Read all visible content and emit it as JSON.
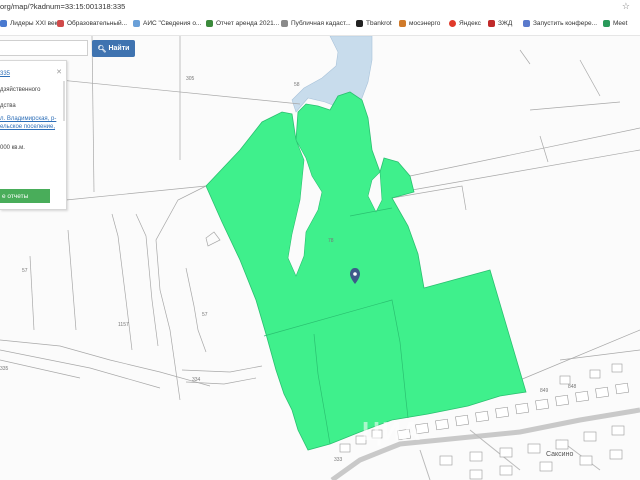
{
  "browser": {
    "url": "org/map/?kadnum=33:15:001318:335",
    "bookmarks": [
      {
        "label": "Лидеры XXI века",
        "color": "#4a7ad0"
      },
      {
        "label": "Образовательный...",
        "color": "#d04a4a"
      },
      {
        "label": "АИС \"Сведения о...",
        "color": "#6aa0d8"
      },
      {
        "label": "Отчет аренда 2021...",
        "color": "#3b8a3b"
      },
      {
        "label": "Публичная кадаст...",
        "color": "#8a8a8a"
      },
      {
        "label": "Tbankrot",
        "color": "#222222"
      },
      {
        "label": "мосэнерго",
        "color": "#d07a2a"
      },
      {
        "label": "Яндекс",
        "color": "#e03a2a"
      },
      {
        "label": "ЗЖД",
        "color": "#c02a2a"
      },
      {
        "label": "Запустить конфере...",
        "color": "#5a7acc"
      },
      {
        "label": "Meet",
        "color": "#2a9a5a"
      }
    ]
  },
  "search": {
    "button_label": "Найти"
  },
  "panel": {
    "cad_num": "335",
    "line1": "дзяйственного",
    "line2": "дства",
    "addr1": "л. Владимирская, р-",
    "addr2": "ельское поселение,",
    "area": "000 кв.м.",
    "button_label": "е отчеты"
  },
  "map": {
    "labels": {
      "l305": "305",
      "l58": "58",
      "l57": "57",
      "l57b": "57",
      "l1157": "1157",
      "l335": "335",
      "l333": "333",
      "l334": "334",
      "l849": "849",
      "l848": "848",
      "l78": "78",
      "saksino": "Саксино"
    },
    "watermark": "ЦИА"
  },
  "colors": {
    "parcel": "#3ff08c",
    "water": "#c8dcec",
    "search_button": "#3f73b0",
    "report_button": "#49ad5a"
  }
}
